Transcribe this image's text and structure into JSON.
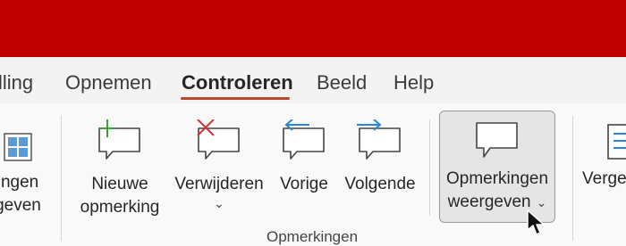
{
  "tabs": [
    {
      "label": "lling"
    },
    {
      "label": "Opnemen"
    },
    {
      "label": "Controleren",
      "active": true
    },
    {
      "label": "Beeld"
    },
    {
      "label": "Help"
    }
  ],
  "ribbon": {
    "left_partial": {
      "line1": "ingen",
      "line2": "geven"
    },
    "buttons": {
      "new_comment": {
        "line1": "Nieuwe",
        "line2": "opmerking"
      },
      "delete": {
        "line1": "Verwijderen",
        "chevron": "⌄"
      },
      "previous": {
        "line1": "Vorige"
      },
      "next": {
        "line1": "Volgende"
      },
      "show_comments": {
        "line1": "Opmerkingen",
        "line2": "weergeven",
        "chevron": "⌄"
      },
      "right_partial": {
        "line1": "Verge"
      }
    },
    "group_label": "Opmerkingen"
  },
  "colors": {
    "titlebar": "#c00000",
    "accent_underline": "#b7472a",
    "icon_green": "#3a9e3a",
    "icon_red": "#d13438",
    "icon_blue": "#2b88d8"
  }
}
